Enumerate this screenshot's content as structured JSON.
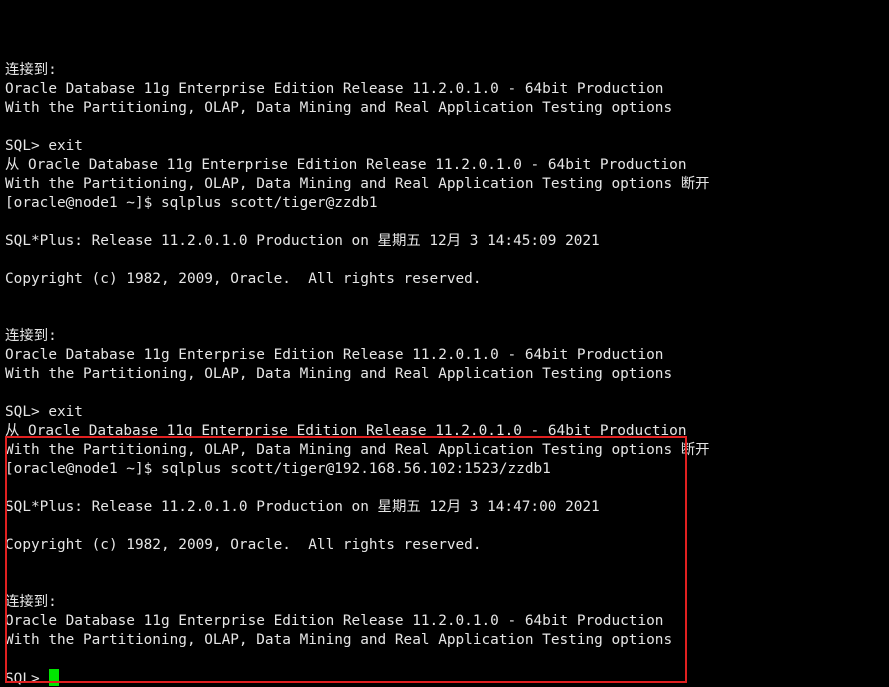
{
  "terminal": {
    "lines": [
      "",
      "连接到:",
      "Oracle Database 11g Enterprise Edition Release 11.2.0.1.0 - 64bit Production",
      "With the Partitioning, OLAP, Data Mining and Real Application Testing options",
      "",
      "SQL> exit",
      "从 Oracle Database 11g Enterprise Edition Release 11.2.0.1.0 - 64bit Production",
      "With the Partitioning, OLAP, Data Mining and Real Application Testing options 断开",
      "[oracle@node1 ~]$ sqlplus scott/tiger@zzdb1",
      "",
      "SQL*Plus: Release 11.2.0.1.0 Production on 星期五 12月 3 14:45:09 2021",
      "",
      "Copyright (c) 1982, 2009, Oracle.  All rights reserved.",
      "",
      "",
      "连接到:",
      "Oracle Database 11g Enterprise Edition Release 11.2.0.1.0 - 64bit Production",
      "With the Partitioning, OLAP, Data Mining and Real Application Testing options",
      "",
      "SQL> exit",
      "从 Oracle Database 11g Enterprise Edition Release 11.2.0.1.0 - 64bit Production",
      "With the Partitioning, OLAP, Data Mining and Real Application Testing options 断开",
      "[oracle@node1 ~]$ sqlplus scott/tiger@192.168.56.102:1523/zzdb1",
      "",
      "SQL*Plus: Release 11.2.0.1.0 Production on 星期五 12月 3 14:47:00 2021",
      "",
      "Copyright (c) 1982, 2009, Oracle.  All rights reserved.",
      "",
      "",
      "连接到:",
      "Oracle Database 11g Enterprise Edition Release 11.2.0.1.0 - 64bit Production",
      "With the Partitioning, OLAP, Data Mining and Real Application Testing options",
      "",
      "SQL> "
    ]
  },
  "colors": {
    "background": "#000000",
    "text": "#e6e6e6",
    "cursor": "#00e600",
    "highlight_border": "#e02020"
  },
  "cursor_icon": "block-cursor-icon"
}
